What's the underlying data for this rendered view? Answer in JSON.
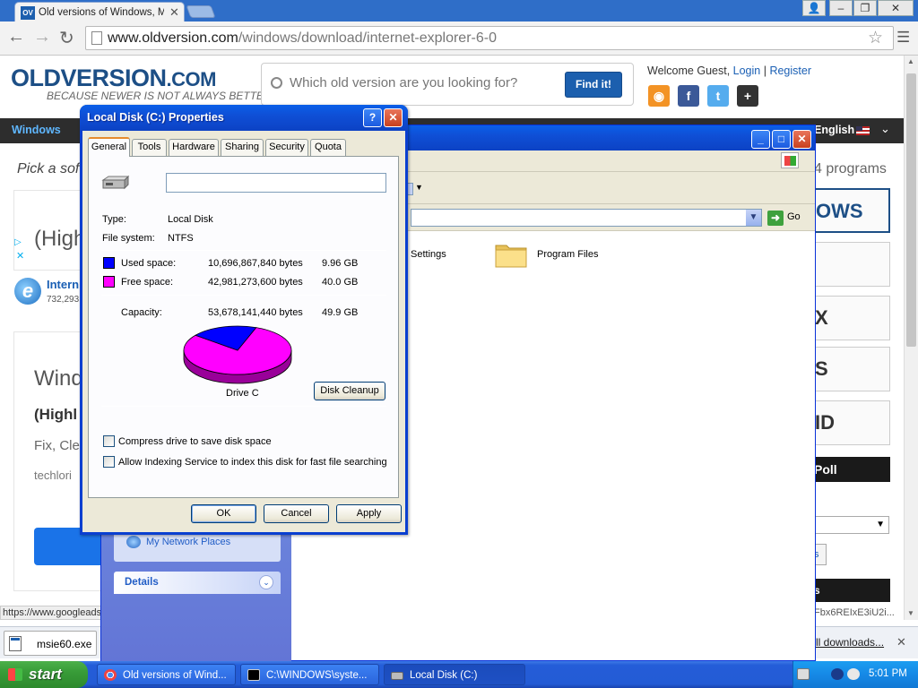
{
  "browser": {
    "tab_title": "Old versions of Windows, Ma",
    "tab_favicon_text": "OV",
    "url_host": "www.oldversion.com",
    "url_path": "/windows/download/internet-explorer-6-0"
  },
  "site": {
    "logo": "OLDVERSION",
    "logo_suffix": ".COM",
    "tagline": "BECAUSE NEWER IS NOT ALWAYS BETTER!",
    "search_placeholder": "Which old version are you looking for?",
    "find_button": "Find it!",
    "welcome": "Welcome Guest,",
    "login": "Login",
    "register": "Register",
    "social": [
      "rss-icon",
      "facebook-icon",
      "twitter-icon",
      "google-plus-icon"
    ],
    "nav_windows": "Windows",
    "nav_language": "English",
    "pick_text": "Pick a sof",
    "programs_text": "4 programs",
    "ad1_text": "(High",
    "ie_title": "Intern",
    "ie_count": "732,293",
    "ad2_title": "Wind",
    "ad2_subtitle": "(Highl",
    "ad2_line": "Fix, Cle",
    "ad2_source": "techlori",
    "right_boxes": [
      "OWS",
      "",
      "X",
      "S",
      "ID"
    ],
    "poll": "Poll",
    "btn_stub": "s",
    "black_stub": "s",
    "status_url": "https://www.googleads",
    "status_right": "Fbx6REIxE3iU2i..."
  },
  "downloads": {
    "file": "msie60.exe",
    "all_link": "ll downloads..."
  },
  "explorer": {
    "go_label": "Go",
    "settings_label": "Settings",
    "program_files": "Program Files",
    "network_places": "My Network Places",
    "details": "Details"
  },
  "dialog": {
    "title": "Local Disk (C:) Properties",
    "tabs": [
      "General",
      "Tools",
      "Hardware",
      "Sharing",
      "Security",
      "Quota"
    ],
    "drive_name_value": "",
    "type_label": "Type:",
    "type_value": "Local Disk",
    "fs_label": "File system:",
    "fs_value": "NTFS",
    "used_label": "Used space:",
    "used_bytes": "10,696,867,840 bytes",
    "used_gb": "9.96 GB",
    "free_label": "Free space:",
    "free_bytes": "42,981,273,600 bytes",
    "free_gb": "40.0 GB",
    "capacity_label": "Capacity:",
    "capacity_bytes": "53,678,141,440 bytes",
    "capacity_gb": "49.9 GB",
    "drive_label": "Drive C",
    "cleanup_button": "Disk Cleanup",
    "compress_label": "Compress drive to save disk space",
    "index_label": "Allow Indexing Service to index this disk for fast file searching",
    "ok": "OK",
    "cancel": "Cancel",
    "apply": "Apply",
    "used_color": "#0000ff",
    "free_color": "#ff00ff",
    "used_fraction": 0.1993
  },
  "taskbar": {
    "start": "start",
    "tasks": [
      "Old versions of Wind...",
      "C:\\WINDOWS\\syste...",
      "Local Disk (C:)"
    ],
    "clock": "5:01 PM"
  }
}
